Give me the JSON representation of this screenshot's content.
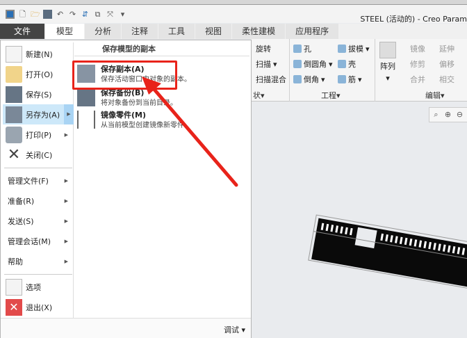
{
  "window": {
    "title": "STEEL (活动的) - Creo Param"
  },
  "quick_access": [
    "app-icon",
    "new-icon",
    "open-icon",
    "save-icon",
    "undo-icon",
    "redo-icon",
    "regenerate-icon",
    "windows-icon",
    "close-window-icon",
    "customize-icon"
  ],
  "tabs": [
    {
      "label": "文件"
    },
    {
      "label": "模型"
    },
    {
      "label": "分析"
    },
    {
      "label": "注释"
    },
    {
      "label": "工具"
    },
    {
      "label": "视图"
    },
    {
      "label": "柔性建模"
    },
    {
      "label": "应用程序"
    }
  ],
  "ribbon": {
    "shape": {
      "items": [
        "旋转",
        "扫描",
        "扫描混合"
      ],
      "label": "状▾"
    },
    "engineering": {
      "items": [
        "孔",
        "倒圆角",
        "倒角",
        "拔模",
        "壳",
        "筋"
      ],
      "label": "工程▾"
    },
    "pattern": {
      "label": "阵列"
    },
    "editing": {
      "items": [
        "镜像",
        "延伸",
        "修剪",
        "偏移",
        "合并",
        "相交"
      ],
      "label": "编辑▾"
    }
  },
  "file_menu": {
    "items": [
      {
        "label": "新建(N)",
        "icon": "new-file-icon"
      },
      {
        "label": "打开(O)",
        "icon": "open-folder-icon"
      },
      {
        "label": "保存(S)",
        "icon": "save-icon"
      },
      {
        "label": "另存为(A)",
        "icon": "save-as-icon",
        "selected": true
      },
      {
        "label": "打印(P)",
        "icon": "print-icon"
      },
      {
        "label": "关闭(C)",
        "icon": "close-icon"
      },
      {
        "label": "管理文件(F)"
      },
      {
        "label": "准备(R)"
      },
      {
        "label": "发送(S)"
      },
      {
        "label": "管理会话(M)"
      },
      {
        "label": "帮助"
      },
      {
        "label": "选项",
        "icon": "options-icon"
      },
      {
        "label": "退出(X)",
        "icon": "exit-icon"
      }
    ],
    "submenu": {
      "header": "保存模型的副本",
      "items": [
        {
          "title": "保存副本(A)",
          "desc": "保存活动窗口中对象的副本。"
        },
        {
          "title": "保存备份(B)",
          "desc": "将对象备份到当前目录。"
        },
        {
          "title": "镜像零件(M)",
          "desc": "从当前模型创建镜像新零件"
        }
      ]
    },
    "debug": "调试 ▾"
  },
  "colors": {
    "highlight": "#e8231a",
    "selected": "#cde8f9",
    "file_tab": "#444444"
  }
}
